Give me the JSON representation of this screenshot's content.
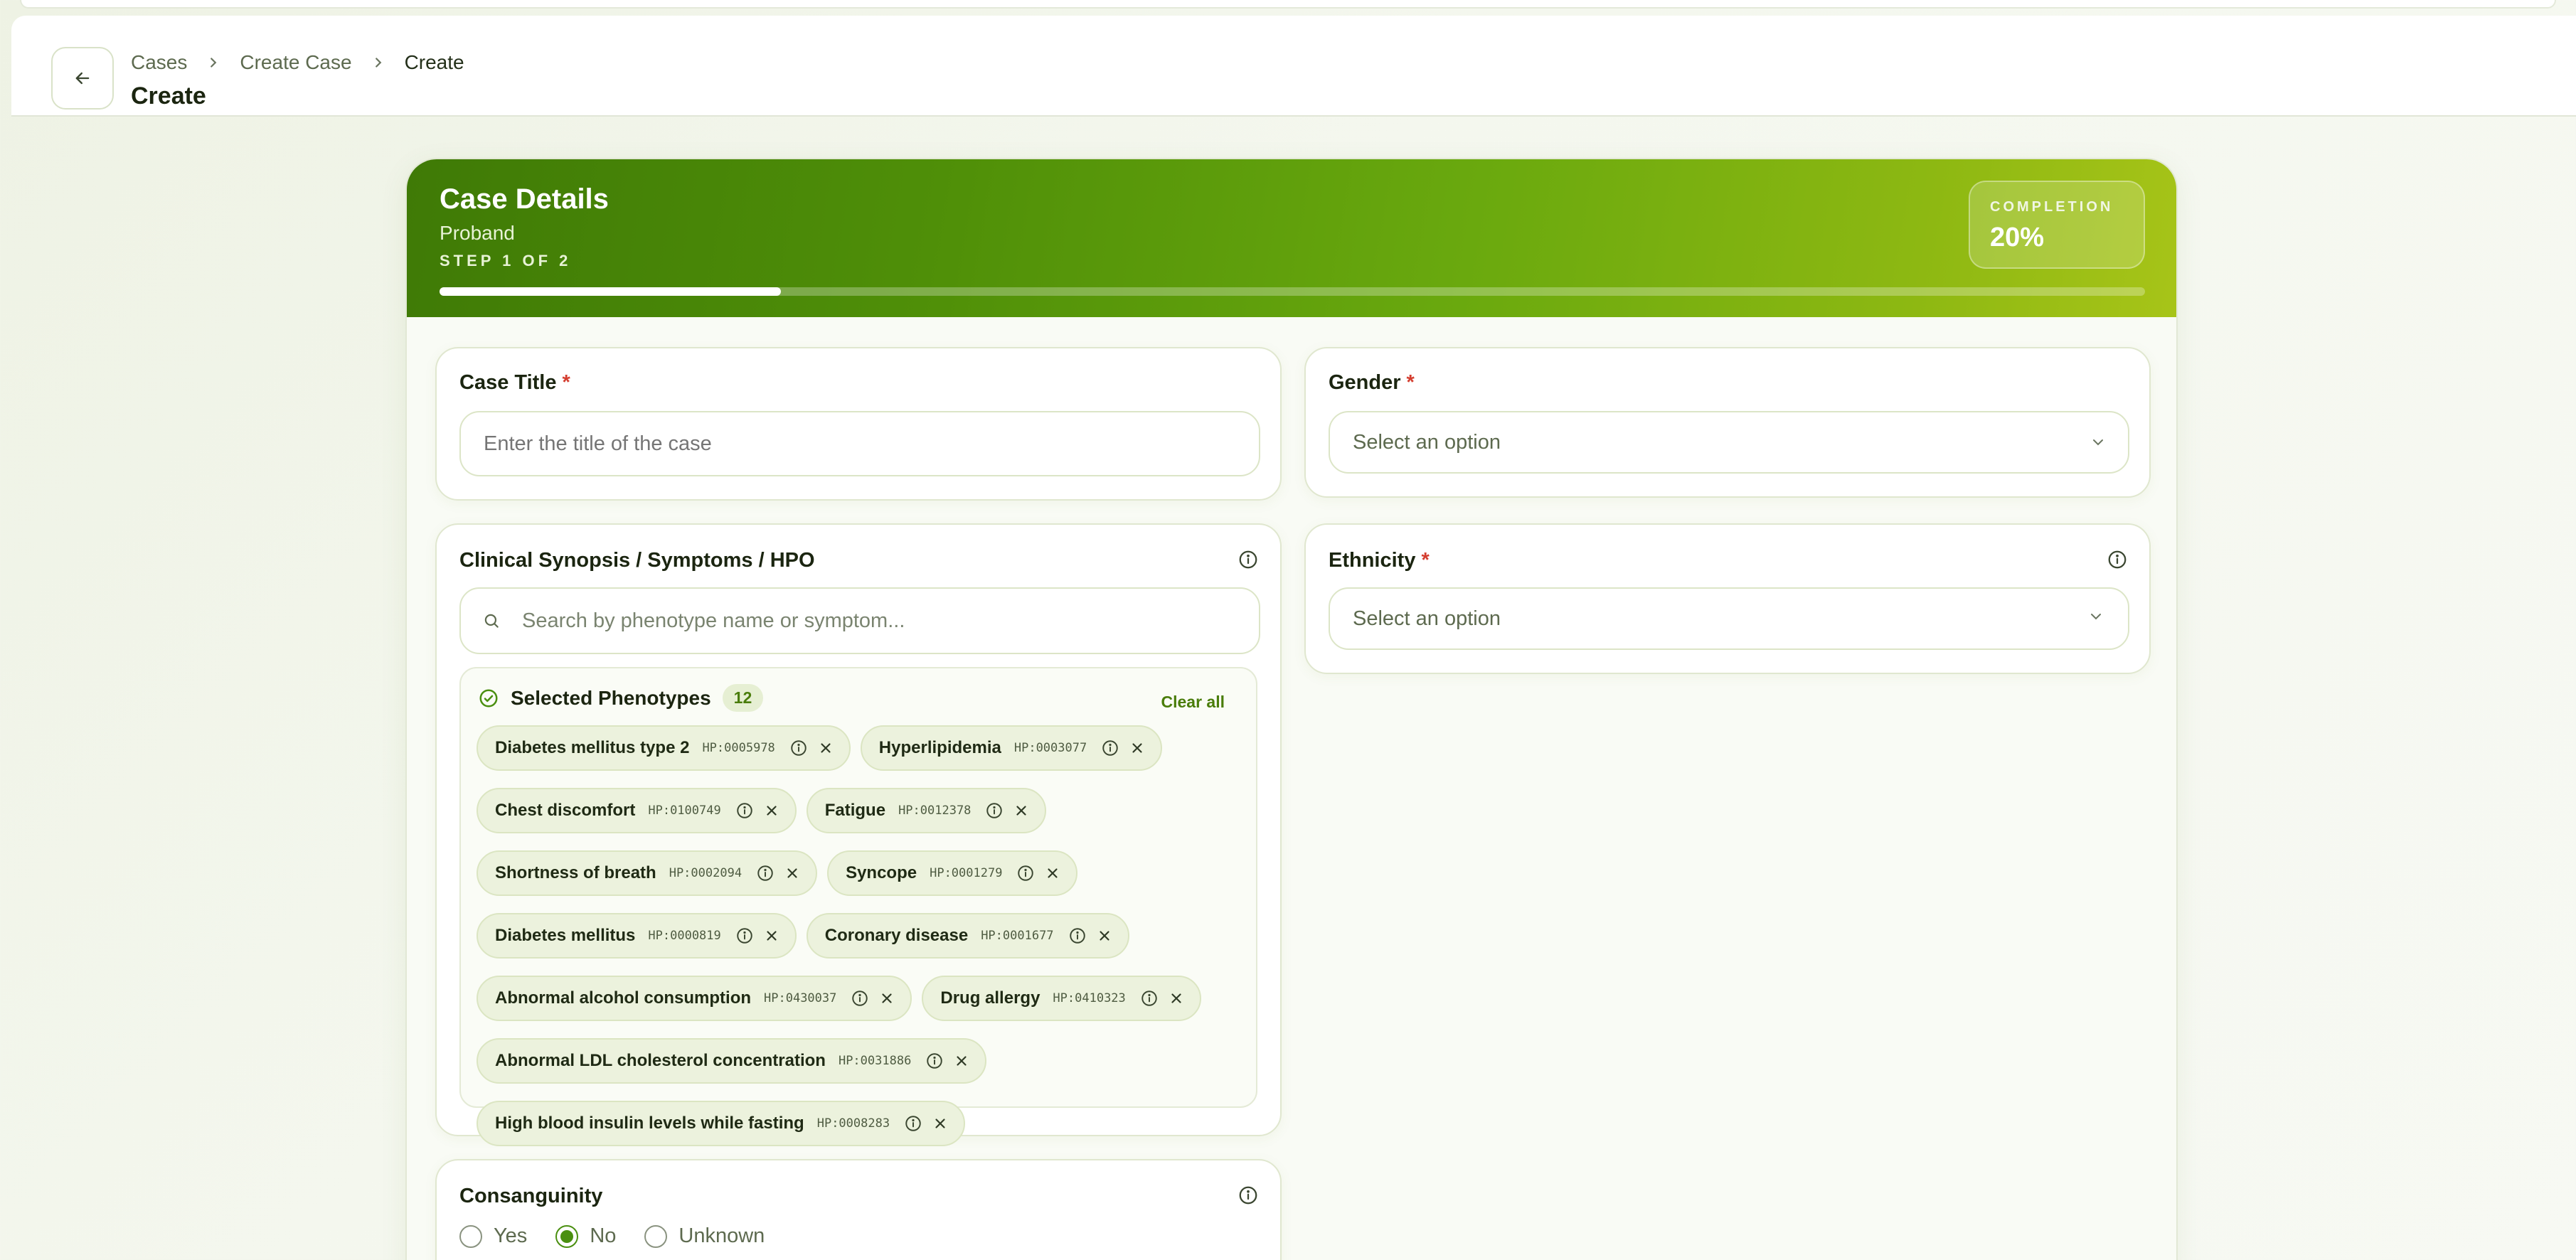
{
  "breadcrumb": {
    "items": [
      "Cases",
      "Create Case"
    ],
    "current": "Create"
  },
  "page": {
    "title": "Create"
  },
  "banner": {
    "title": "Case Details",
    "subtitle": "Proband",
    "step": "STEP 1 OF 2",
    "completion_label": "COMPLETION",
    "completion_value": "20%",
    "progress_fraction": 0.2
  },
  "case_title": {
    "label": "Case Title",
    "required": "*",
    "placeholder": "Enter the title of the case"
  },
  "gender": {
    "label": "Gender",
    "required": "*",
    "value": "Select an option"
  },
  "ethnicity": {
    "label": "Ethnicity",
    "required": "*",
    "value": "Select an option"
  },
  "clinical": {
    "label": "Clinical Synopsis / Symptoms / HPO",
    "search_placeholder": "Search by phenotype name or symptom...",
    "selected_title": "Selected Phenotypes",
    "selected_count": "12",
    "clear_all": "Clear all",
    "phenotypes": [
      {
        "name": "Diabetes mellitus type 2",
        "code": "HP:0005978"
      },
      {
        "name": "Hyperlipidemia",
        "code": "HP:0003077"
      },
      {
        "name": "Chest discomfort",
        "code": "HP:0100749"
      },
      {
        "name": "Fatigue",
        "code": "HP:0012378"
      },
      {
        "name": "Shortness of breath",
        "code": "HP:0002094"
      },
      {
        "name": "Syncope",
        "code": "HP:0001279"
      },
      {
        "name": "Diabetes mellitus",
        "code": "HP:0000819"
      },
      {
        "name": "Coronary disease",
        "code": "HP:0001677"
      },
      {
        "name": "Abnormal alcohol consumption",
        "code": "HP:0430037"
      },
      {
        "name": "Drug allergy",
        "code": "HP:0410323"
      },
      {
        "name": "Abnormal LDL cholesterol concentration",
        "code": "HP:0031886"
      },
      {
        "name": "High blood insulin levels while fasting",
        "code": "HP:0008283"
      }
    ]
  },
  "consanguinity": {
    "label": "Consanguinity",
    "options": [
      "Yes",
      "No",
      "Unknown"
    ],
    "selected": "No"
  },
  "colors": {
    "accent": "#4a8f10",
    "required": "#d43d2f",
    "banner_start": "#3f7a06",
    "banner_end": "#a7c418"
  },
  "icons": [
    "arrow-left-icon",
    "chevron-right-icon",
    "chevron-down-icon",
    "search-icon",
    "info-icon",
    "check-circle-icon",
    "close-icon"
  ]
}
